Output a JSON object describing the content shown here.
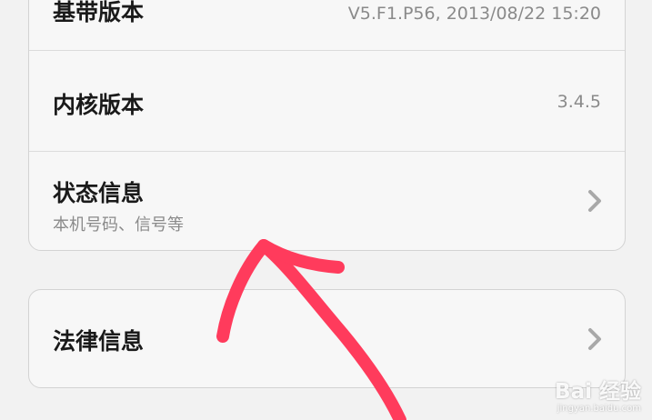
{
  "about": {
    "baseband": {
      "title": "基带版本",
      "value": "V5.F1.P56, 2013/08/22 15:20"
    },
    "kernel": {
      "title": "内核版本",
      "value": "3.4.5"
    },
    "status": {
      "title": "状态信息",
      "subtitle": "本机号码、信号等",
      "icon": "chevron-right-icon"
    },
    "legal": {
      "title": "法律信息",
      "icon": "chevron-right-icon"
    }
  },
  "annotation": {
    "color": "#ff3b5c"
  },
  "watermark": {
    "brand": "Bai 经验",
    "url": "jingyan.baidu.com"
  }
}
